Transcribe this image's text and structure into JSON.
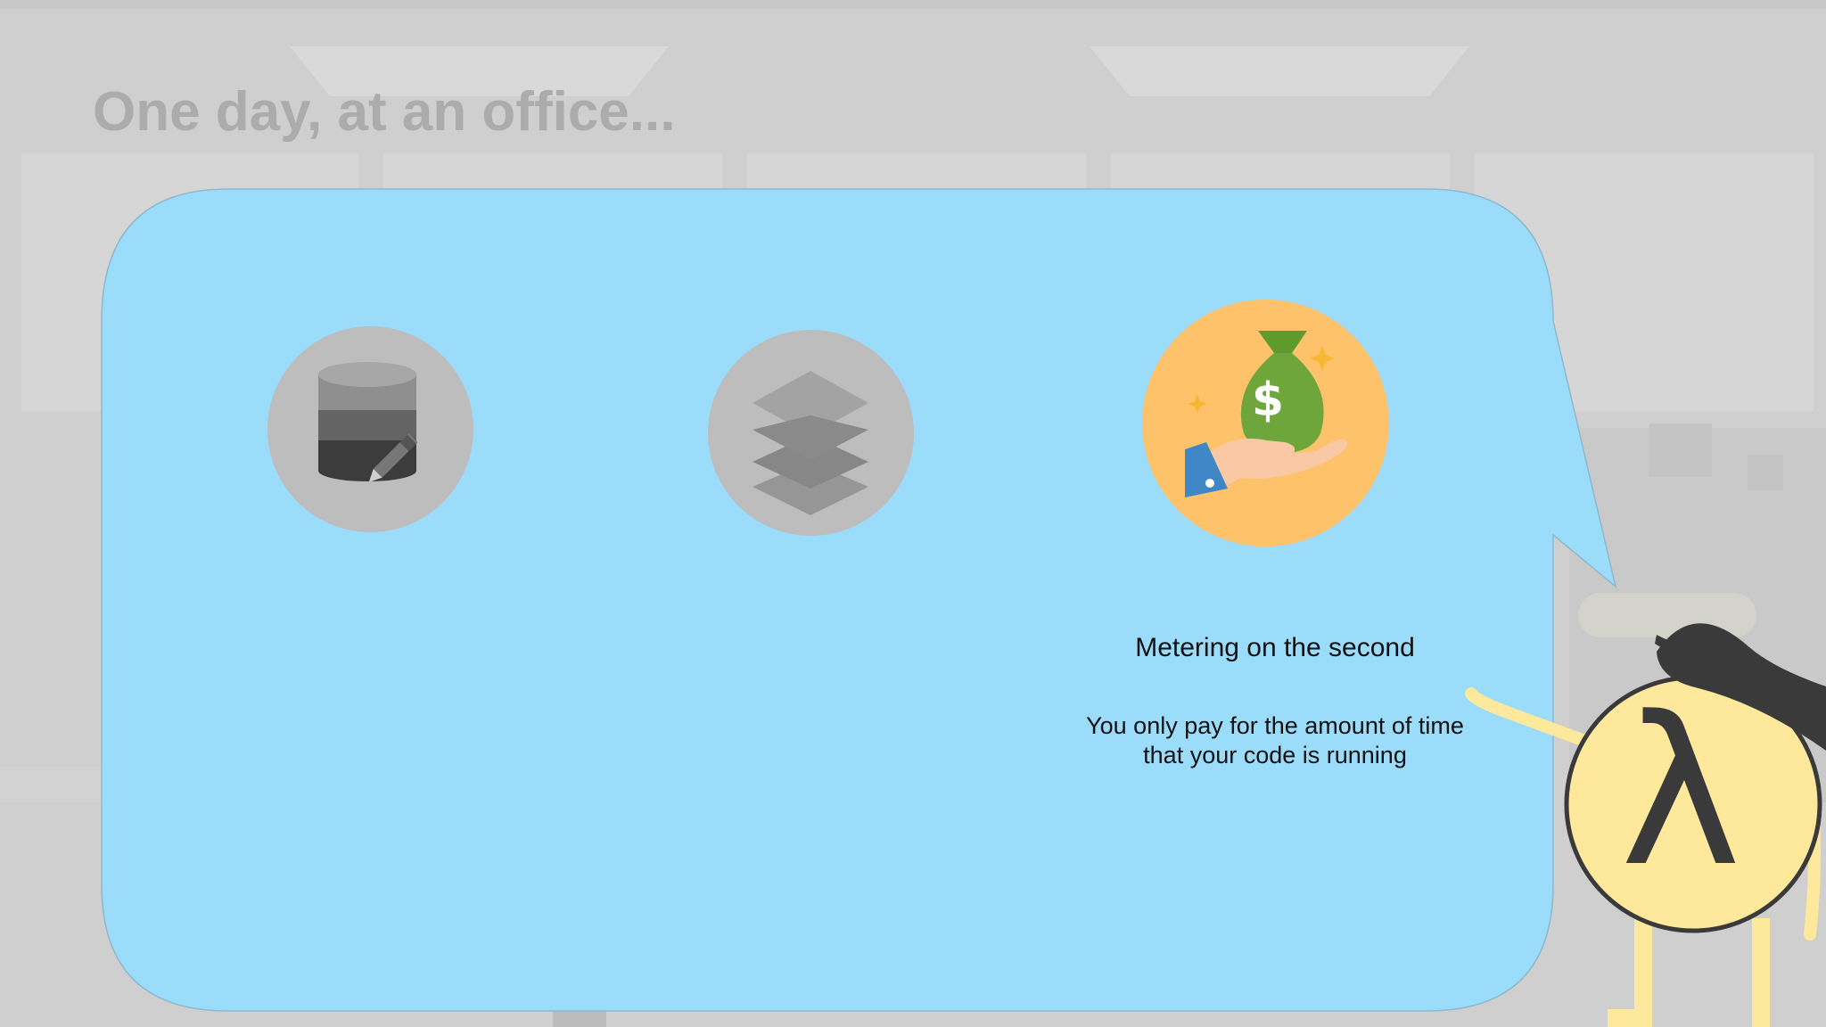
{
  "slide": {
    "title": "One day, at an office..."
  },
  "features": [
    {
      "icon": "database-edit-icon",
      "title": "",
      "description": ""
    },
    {
      "icon": "layers-icon",
      "title": "",
      "description": ""
    },
    {
      "icon": "money-bag-hand-icon",
      "title": "Metering on the second",
      "description_line1": "You only pay for the amount of time",
      "description_line2": "that your code is running"
    }
  ],
  "character": {
    "symbol": "λ",
    "icon": "lambda-character-icon"
  },
  "colors": {
    "background": "#cfcfcf",
    "bubble": "#9bdcfb",
    "inactive_icon_bg": "#bdbdbd",
    "active_icon_bg": "#fec26b",
    "money_bag": "#6fa63b",
    "character_face": "#fde89b",
    "hat": "#3a3a3a"
  }
}
